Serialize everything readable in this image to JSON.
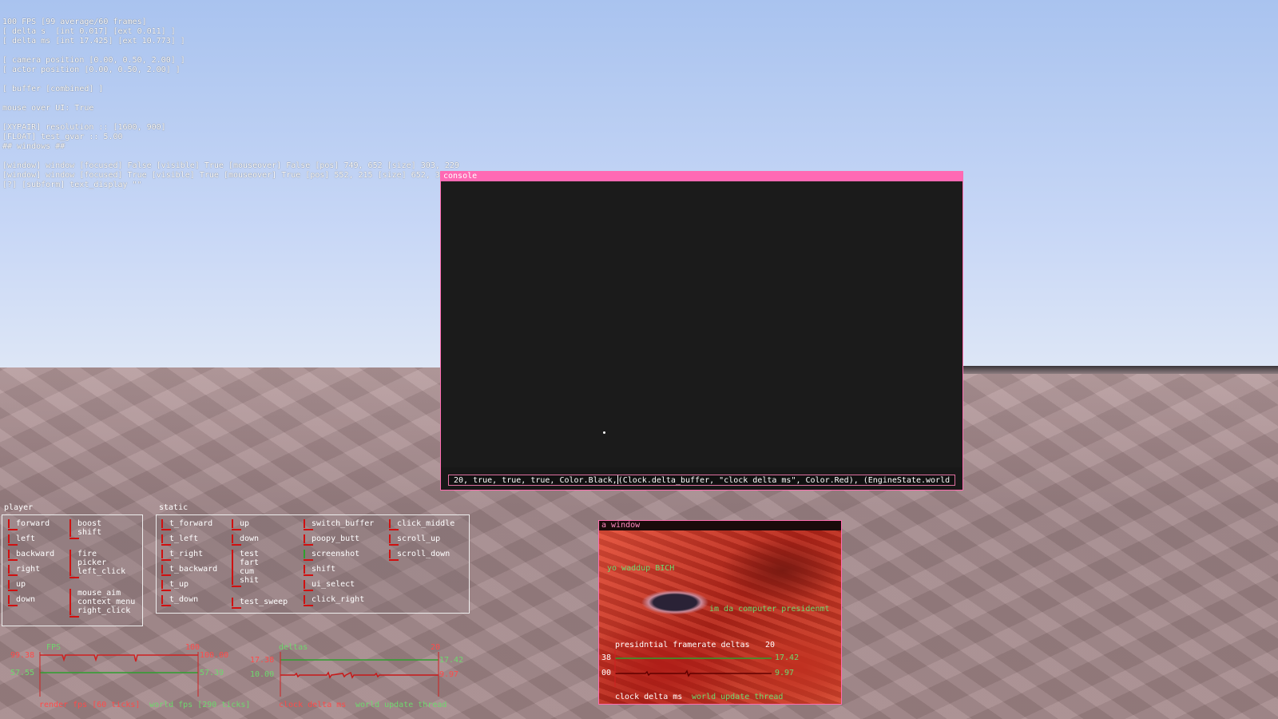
{
  "debug_lines": [
    "100 FPS [99 average/60 frames]",
    "[ delta s  [int 0.017] [ext 0.011] ]",
    "[ delta ms [int 17.425] [ext 10.773] ]",
    "",
    "[ camera position [0.00, 0.50, 2.00] ]",
    "[ actor position [0.00, 0.50, 2.00] ]",
    "",
    "[ buffer [combined] ]",
    "",
    "mouse over UI: True",
    "",
    "[XYPAIR] resolution :: [1600, 900]",
    "[FLOAT] test_gvar :: 5.00",
    "## windows ##",
    "",
    "[window] window [focused] False [visible] True [mouseover] False [pos] 749, 652 [size] 303, 229",
    "[window] window [focused] True [visible] True [mouseover] True [pos] 552, 215 [size] 652, 39",
    "[?] [subform] text_display \"\""
  ],
  "console": {
    "title": "console",
    "input_before": " 20, true, true, true, Color.Black,",
    "input_after": "(Clock.delta_buffer, \"clock delta ms\", Color.Red), (EngineState.world"
  },
  "player": {
    "label": "player",
    "col1": [
      "forward",
      "left",
      "backward",
      "right",
      "up",
      "down"
    ],
    "col2": [
      "boost\nshift",
      "fire\npicker\nleft_click",
      "mouse_aim\ncontext_menu\nright_click"
    ]
  },
  "static": {
    "label": "static",
    "col1": [
      "t_forward",
      "t_left",
      "t_right",
      "t_backward",
      "t_up",
      "t_down"
    ],
    "col2": [
      "up",
      "down",
      "test\nfart\ncum\nshit",
      "test_sweep"
    ],
    "col3": [
      "switch_buffer",
      "poopy_butt",
      "screenshot",
      "shift",
      "ui_select",
      "click_right"
    ],
    "col4": [
      "click_middle",
      "scroll_up",
      "scroll_down"
    ]
  },
  "fps_graph": {
    "title": "FPS",
    "max": "100",
    "left_top": "99.38",
    "left_bottom": "57.55",
    "right_top": "100.00",
    "right_bottom": "57.39",
    "legend_red": "render fps [60 ticks]",
    "legend_green": "world fps [290 ticks]"
  },
  "delta_graph": {
    "title": "deltas",
    "max": "20",
    "left_top": "17.38",
    "left_bottom": "10.00",
    "right_top": "17.42",
    "right_bottom": "9.97",
    "legend_red": "clock delta ms",
    "legend_green": "world update thread"
  },
  "a_window": {
    "title": "a window",
    "text1": "yo waddup BICH",
    "text2": "im da computer presidenmt",
    "graph_title": "presidntial framerate deltas",
    "graph_max": "20",
    "left_top": "38",
    "left_bottom": "00",
    "right_top": "17.42",
    "right_bottom": "9.97",
    "legend_red": "clock delta ms",
    "legend_green": "world update thread"
  },
  "colors": {
    "accent": "#ff69b4",
    "key_red": "#d01010",
    "key_green": "#2ea02e",
    "graph_red": "#ff4a4a",
    "graph_green": "#6ed86e"
  }
}
